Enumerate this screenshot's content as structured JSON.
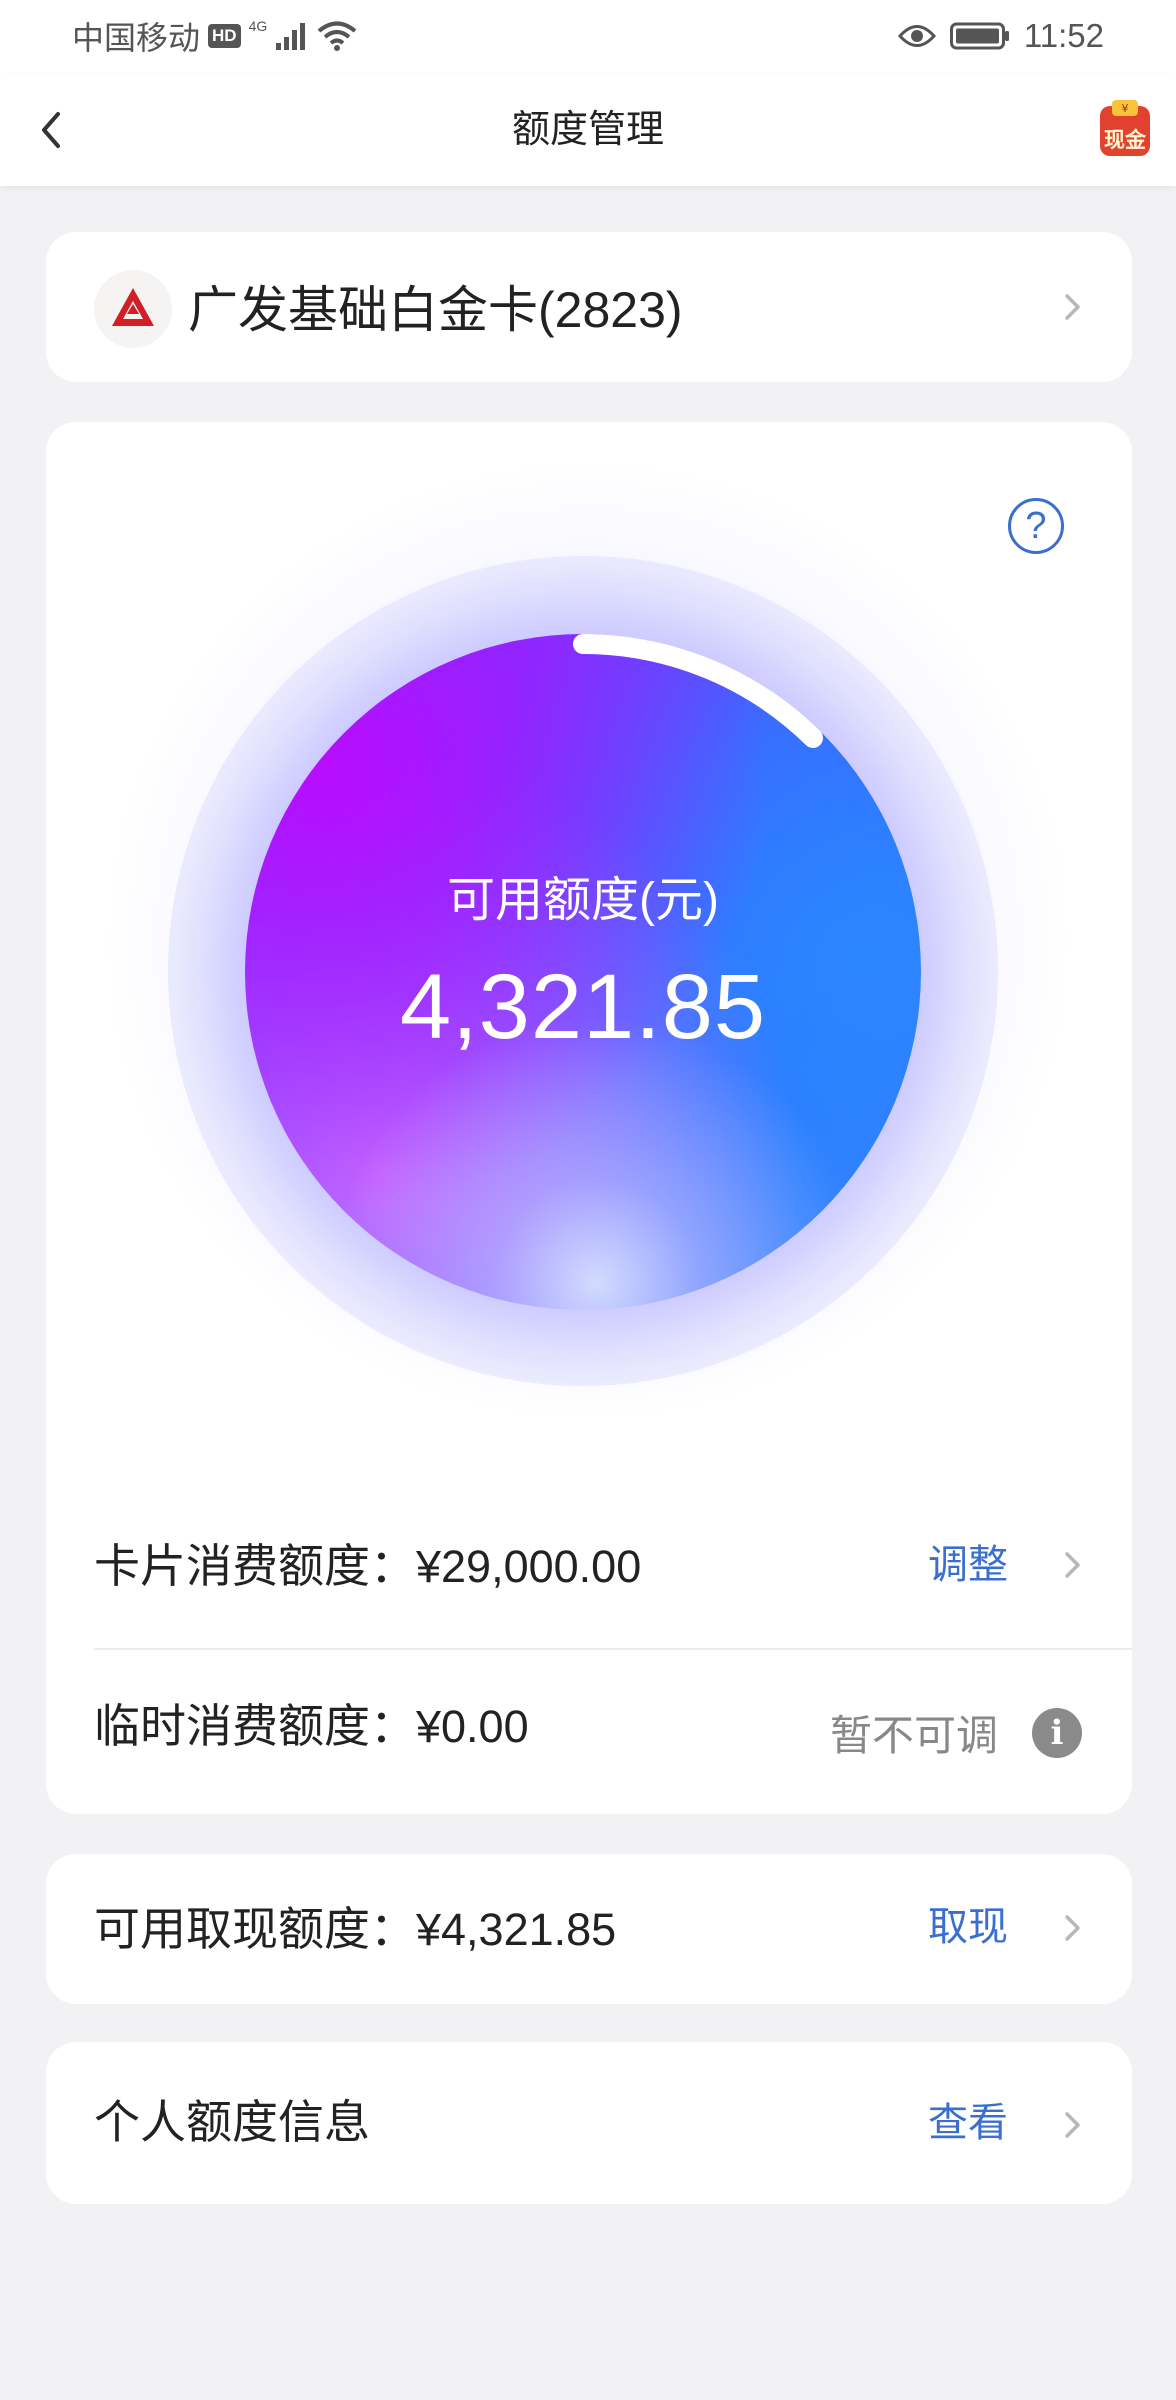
{
  "status_bar": {
    "carrier": "中国移动",
    "hd": "HD",
    "network": "4G",
    "time": "11:52"
  },
  "nav": {
    "title": "额度管理",
    "badge_text": "现金"
  },
  "card": {
    "name": "广发基础白金卡(2823)"
  },
  "balance": {
    "label": "可用额度(元)",
    "value": "4,321.85",
    "help_symbol": "?"
  },
  "limits": [
    {
      "label": "卡片消费额度：",
      "value": "¥29,000.00",
      "action": "调整"
    },
    {
      "label": "临时消费额度：",
      "value": "¥0.00",
      "status": "暂不可调",
      "info_symbol": "i"
    }
  ],
  "cash": {
    "label": "可用取现额度：",
    "value": "¥4,321.85",
    "action": "取现"
  },
  "personal": {
    "label": "个人额度信息",
    "action": "查看"
  },
  "colors": {
    "accent": "#3a6fd0",
    "background": "#f2f2f4",
    "brand_red": "#d21f26"
  },
  "icons": {
    "back": "chevron-left-icon",
    "help": "question-circle-icon",
    "info": "info-circle-icon",
    "chevron": "chevron-right-icon"
  }
}
